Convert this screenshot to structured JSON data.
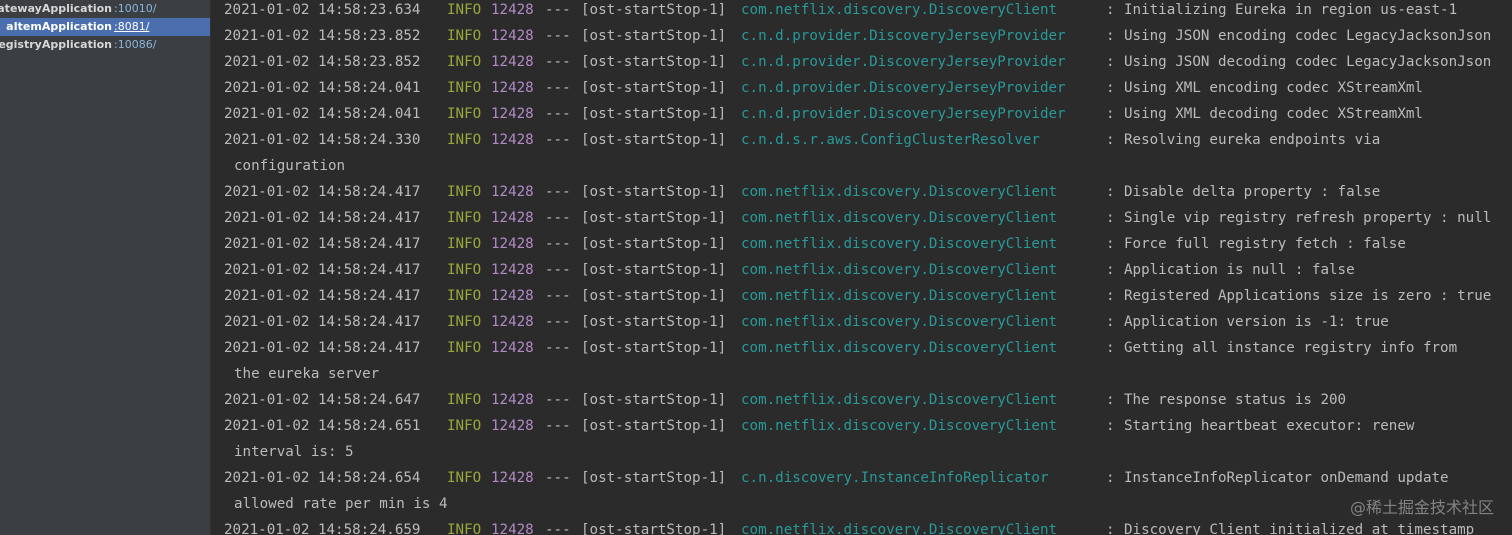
{
  "services": [
    {
      "name": "aGatewayApplication",
      "port": ":10010/",
      "selected": false
    },
    {
      "name": "aItemApplication",
      "port": ":8081/",
      "selected": true
    },
    {
      "name": "aRegistryApplication",
      "port": ":10086/",
      "selected": false
    }
  ],
  "log_lines": [
    {
      "type": "entry",
      "timestamp": "2021-01-02 14:58:23.634",
      "level": "INFO",
      "pid": "12428",
      "sep": "---",
      "thread": "[ost-startStop-1]",
      "logger": "com.netflix.discovery.DiscoveryClient",
      "message": "Initializing Eureka in region us-east-1"
    },
    {
      "type": "entry",
      "timestamp": "2021-01-02 14:58:23.852",
      "level": "INFO",
      "pid": "12428",
      "sep": "---",
      "thread": "[ost-startStop-1]",
      "logger": "c.n.d.provider.DiscoveryJerseyProvider",
      "message": "Using JSON encoding codec LegacyJacksonJson"
    },
    {
      "type": "entry",
      "timestamp": "2021-01-02 14:58:23.852",
      "level": "INFO",
      "pid": "12428",
      "sep": "---",
      "thread": "[ost-startStop-1]",
      "logger": "c.n.d.provider.DiscoveryJerseyProvider",
      "message": "Using JSON decoding codec LegacyJacksonJson"
    },
    {
      "type": "entry",
      "timestamp": "2021-01-02 14:58:24.041",
      "level": "INFO",
      "pid": "12428",
      "sep": "---",
      "thread": "[ost-startStop-1]",
      "logger": "c.n.d.provider.DiscoveryJerseyProvider",
      "message": "Using XML encoding codec XStreamXml"
    },
    {
      "type": "entry",
      "timestamp": "2021-01-02 14:58:24.041",
      "level": "INFO",
      "pid": "12428",
      "sep": "---",
      "thread": "[ost-startStop-1]",
      "logger": "c.n.d.provider.DiscoveryJerseyProvider",
      "message": "Using XML decoding codec XStreamXml"
    },
    {
      "type": "entry",
      "timestamp": "2021-01-02 14:58:24.330",
      "level": "INFO",
      "pid": "12428",
      "sep": "---",
      "thread": "[ost-startStop-1]",
      "logger": "c.n.d.s.r.aws.ConfigClusterResolver",
      "message": "Resolving eureka endpoints via"
    },
    {
      "type": "cont",
      "text": "configuration"
    },
    {
      "type": "entry",
      "timestamp": "2021-01-02 14:58:24.417",
      "level": "INFO",
      "pid": "12428",
      "sep": "---",
      "thread": "[ost-startStop-1]",
      "logger": "com.netflix.discovery.DiscoveryClient",
      "message": "Disable delta property : false"
    },
    {
      "type": "entry",
      "timestamp": "2021-01-02 14:58:24.417",
      "level": "INFO",
      "pid": "12428",
      "sep": "---",
      "thread": "[ost-startStop-1]",
      "logger": "com.netflix.discovery.DiscoveryClient",
      "message": "Single vip registry refresh property : null"
    },
    {
      "type": "entry",
      "timestamp": "2021-01-02 14:58:24.417",
      "level": "INFO",
      "pid": "12428",
      "sep": "---",
      "thread": "[ost-startStop-1]",
      "logger": "com.netflix.discovery.DiscoveryClient",
      "message": "Force full registry fetch : false"
    },
    {
      "type": "entry",
      "timestamp": "2021-01-02 14:58:24.417",
      "level": "INFO",
      "pid": "12428",
      "sep": "---",
      "thread": "[ost-startStop-1]",
      "logger": "com.netflix.discovery.DiscoveryClient",
      "message": "Application is null : false"
    },
    {
      "type": "entry",
      "timestamp": "2021-01-02 14:58:24.417",
      "level": "INFO",
      "pid": "12428",
      "sep": "---",
      "thread": "[ost-startStop-1]",
      "logger": "com.netflix.discovery.DiscoveryClient",
      "message": "Registered Applications size is zero : true"
    },
    {
      "type": "entry",
      "timestamp": "2021-01-02 14:58:24.417",
      "level": "INFO",
      "pid": "12428",
      "sep": "---",
      "thread": "[ost-startStop-1]",
      "logger": "com.netflix.discovery.DiscoveryClient",
      "message": "Application version is -1: true"
    },
    {
      "type": "entry",
      "timestamp": "2021-01-02 14:58:24.417",
      "level": "INFO",
      "pid": "12428",
      "sep": "---",
      "thread": "[ost-startStop-1]",
      "logger": "com.netflix.discovery.DiscoveryClient",
      "message": "Getting all instance registry info from"
    },
    {
      "type": "cont",
      "text": "the eureka server"
    },
    {
      "type": "entry",
      "timestamp": "2021-01-02 14:58:24.647",
      "level": "INFO",
      "pid": "12428",
      "sep": "---",
      "thread": "[ost-startStop-1]",
      "logger": "com.netflix.discovery.DiscoveryClient",
      "message": "The response status is 200"
    },
    {
      "type": "entry",
      "timestamp": "2021-01-02 14:58:24.651",
      "level": "INFO",
      "pid": "12428",
      "sep": "---",
      "thread": "[ost-startStop-1]",
      "logger": "com.netflix.discovery.DiscoveryClient",
      "message": "Starting heartbeat executor: renew"
    },
    {
      "type": "cont",
      "text": "interval is: 5"
    },
    {
      "type": "entry",
      "timestamp": "2021-01-02 14:58:24.654",
      "level": "INFO",
      "pid": "12428",
      "sep": "---",
      "thread": "[ost-startStop-1]",
      "logger": "c.n.discovery.InstanceInfoReplicator",
      "message": "InstanceInfoReplicator onDemand update"
    },
    {
      "type": "cont",
      "text": "allowed rate per min is 4"
    },
    {
      "type": "entry",
      "timestamp": "2021-01-02 14:58:24.659",
      "level": "INFO",
      "pid": "12428",
      "sep": "---",
      "thread": "[ost-startStop-1]",
      "logger": "com.netflix.discovery.DiscoveryClient",
      "message": "Discovery Client initialized at timestamp"
    }
  ],
  "watermark": "@稀土掘金技术社区",
  "colors": {
    "background": "#2b2b2b",
    "sidebar": "#3c3f41",
    "selected": "#4b6eaf",
    "info": "#9aa83a",
    "pid": "#b28ac5",
    "logger": "#299999",
    "text": "#bbbbbb"
  }
}
